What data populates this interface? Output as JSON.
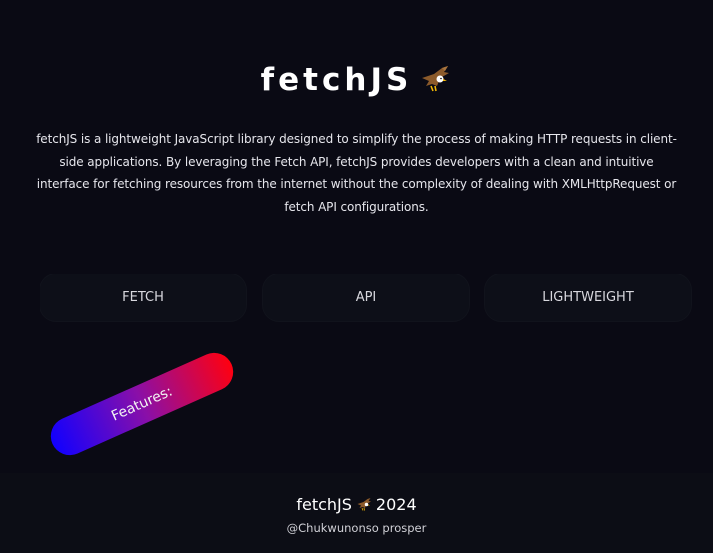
{
  "hero": {
    "title": "fetchJS",
    "icon": "eagle-icon",
    "description": "fetchJS is a lightweight JavaScript library designed to simplify the process of making HTTP requests in client-side applications. By leveraging the Fetch API, fetchJS provides developers with a clean and intuitive interface for fetching resources from the internet without the complexity of dealing with XMLHttpRequest or fetch API configurations."
  },
  "tags": [
    {
      "label": "FETCH"
    },
    {
      "label": "API"
    },
    {
      "label": "LIGHTWEIGHT"
    }
  ],
  "features": {
    "label": "Features:"
  },
  "footer": {
    "title": "fetchJS",
    "year": "2024",
    "credit": "@Chukwunonso prosper"
  },
  "colors": {
    "background": "#0a0a14",
    "tag_background": "#0d0f18",
    "gradient_start": "#1100ff",
    "gradient_end": "#ff0010"
  }
}
